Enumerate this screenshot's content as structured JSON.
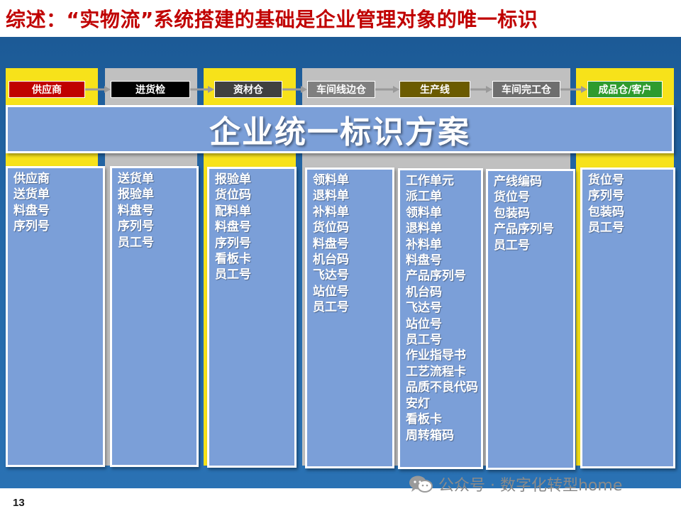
{
  "title": "综述：“实物流”系统搭建的基础是企业管理对象的唯一标识",
  "page_number": "13",
  "watermark": "公众号 · 数字化转型home",
  "colors": {
    "title": "#c00000",
    "background_blue": "#2468a8",
    "yellow_column": "#f7e21a",
    "gray_column": "#c0c0c0",
    "box_fill": "#7b9fd8",
    "stage_supplier": "#c00000",
    "stage_receiving": "#000000",
    "stage_material": "#404040",
    "stage_line": "#7f7f7f",
    "stage_production": "#6b5b00",
    "stage_finished_shop": "#6e6e6e",
    "stage_customer": "#2e9b2e"
  },
  "stages": [
    {
      "label": "供应商",
      "color": "#c00000"
    },
    {
      "label": "进货检",
      "color": "#000000"
    },
    {
      "label": "资材仓",
      "color": "#404040"
    },
    {
      "label": "车间线边仓",
      "color": "#7f7f7f"
    },
    {
      "label": "生产线",
      "color": "#6b5b00"
    },
    {
      "label": "车间完工仓",
      "color": "#6e6e6e"
    },
    {
      "label": "成品仓/客户",
      "color": "#2e9b2e"
    }
  ],
  "banner": "企业统一标识方案",
  "boxes": [
    {
      "items": [
        "供应商",
        "送货单",
        "料盘号",
        "序列号"
      ]
    },
    {
      "items": [
        "送货单",
        "报验单",
        "料盘号",
        "序列号",
        "员工号"
      ]
    },
    {
      "items": [
        "报验单",
        "货位码",
        "配料单",
        "料盘号",
        "序列号",
        "看板卡",
        "员工号"
      ]
    },
    {
      "items": [
        "领料单",
        "退料单",
        "补料单",
        "货位码",
        "料盘号",
        "机台码",
        "飞达号",
        "站位号",
        "员工号"
      ]
    },
    {
      "items": [
        "工作单元",
        "派工单",
        "领料单",
        "退料单",
        "补料单",
        "料盘号",
        "产品序列号",
        "机台码",
        "飞达号",
        "站位号",
        "员工号",
        "作业指导书",
        "工艺流程卡",
        "品质不良代码",
        "安灯",
        "看板卡",
        "周转箱码"
      ]
    },
    {
      "items": [
        "产线编码",
        "货位号",
        "包装码",
        "产品序列号",
        "员工号"
      ]
    },
    {
      "items": [
        "货位号",
        "序列号",
        "包装码",
        "员工号"
      ]
    }
  ]
}
